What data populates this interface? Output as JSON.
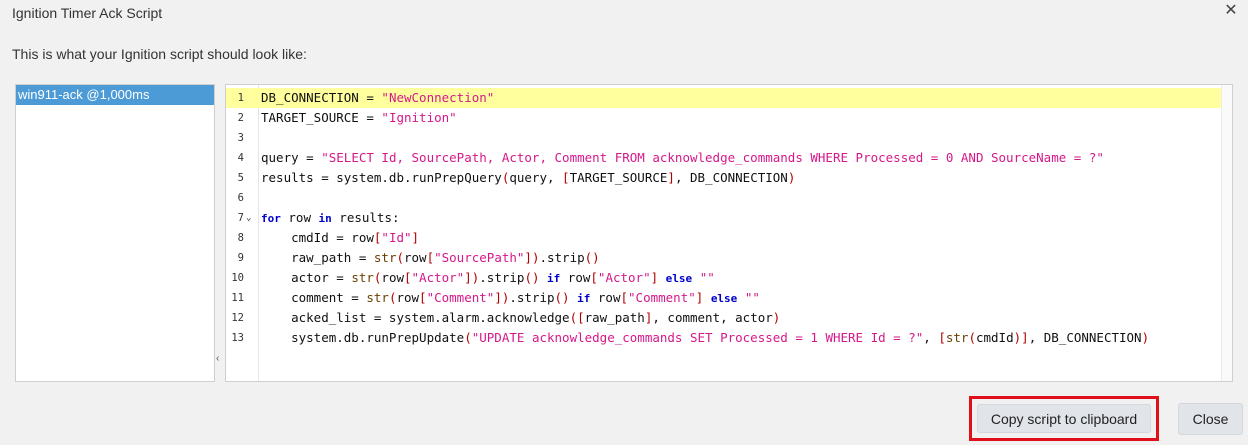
{
  "dialog": {
    "title": "Ignition Timer Ack Script",
    "close_icon": "close-icon",
    "subtitle": "This is what your Ignition script should look like:"
  },
  "list": {
    "items": [
      "win911-ack @1,000ms"
    ],
    "selected_index": 0
  },
  "splitter": {
    "arrow": "‹"
  },
  "editor": {
    "current_line": 1,
    "fold_icon": "chevron-down-icon",
    "fold_glyph": "⌄",
    "line_numbers": [
      "1",
      "2",
      "3",
      "4",
      "5",
      "6",
      "7",
      "8",
      "9",
      "10",
      "11",
      "12",
      "13"
    ]
  },
  "buttons": {
    "copy": "Copy script to clipboard",
    "close": "Close"
  },
  "colors": {
    "accent_selection": "#4d9bd6",
    "current_line": "#ffff9e",
    "string": "#d6188a",
    "keyword": "#0000cc",
    "highlight_border": "#e0101a"
  }
}
